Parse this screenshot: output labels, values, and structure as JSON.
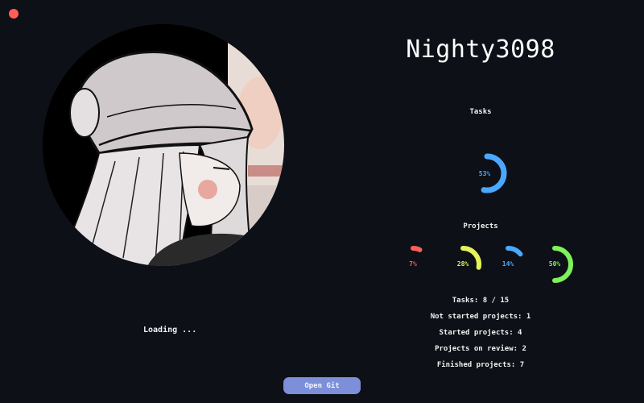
{
  "window": {
    "close_icon": "close-icon",
    "close_color": "#ff5f5a"
  },
  "profile": {
    "username": "Nighty3098",
    "loading_text": "Loading ..."
  },
  "tasks_section": {
    "title": "Tasks",
    "gauge": {
      "label": "53%",
      "value": 53,
      "color": "#4aa8ff"
    }
  },
  "projects_section": {
    "title": "Projects",
    "gauges": [
      {
        "label": "7%",
        "value": 7,
        "color": "#ff5f5a"
      },
      {
        "label": "28%",
        "value": 28,
        "color": "#e6f25a"
      },
      {
        "label": "14%",
        "value": 14,
        "color": "#4aa8ff"
      },
      {
        "label": "50%",
        "value": 50,
        "color": "#7ef25a"
      }
    ]
  },
  "stats": {
    "tasks": "Tasks: 8 / 15",
    "not_started": "Not started projects: 1",
    "started": "Started projects: 4",
    "on_review": "Projects on review: 2",
    "finished": "Finished projects: 7"
  },
  "actions": {
    "open_git_label": "Open Git",
    "accent": "#7d8fd9"
  }
}
